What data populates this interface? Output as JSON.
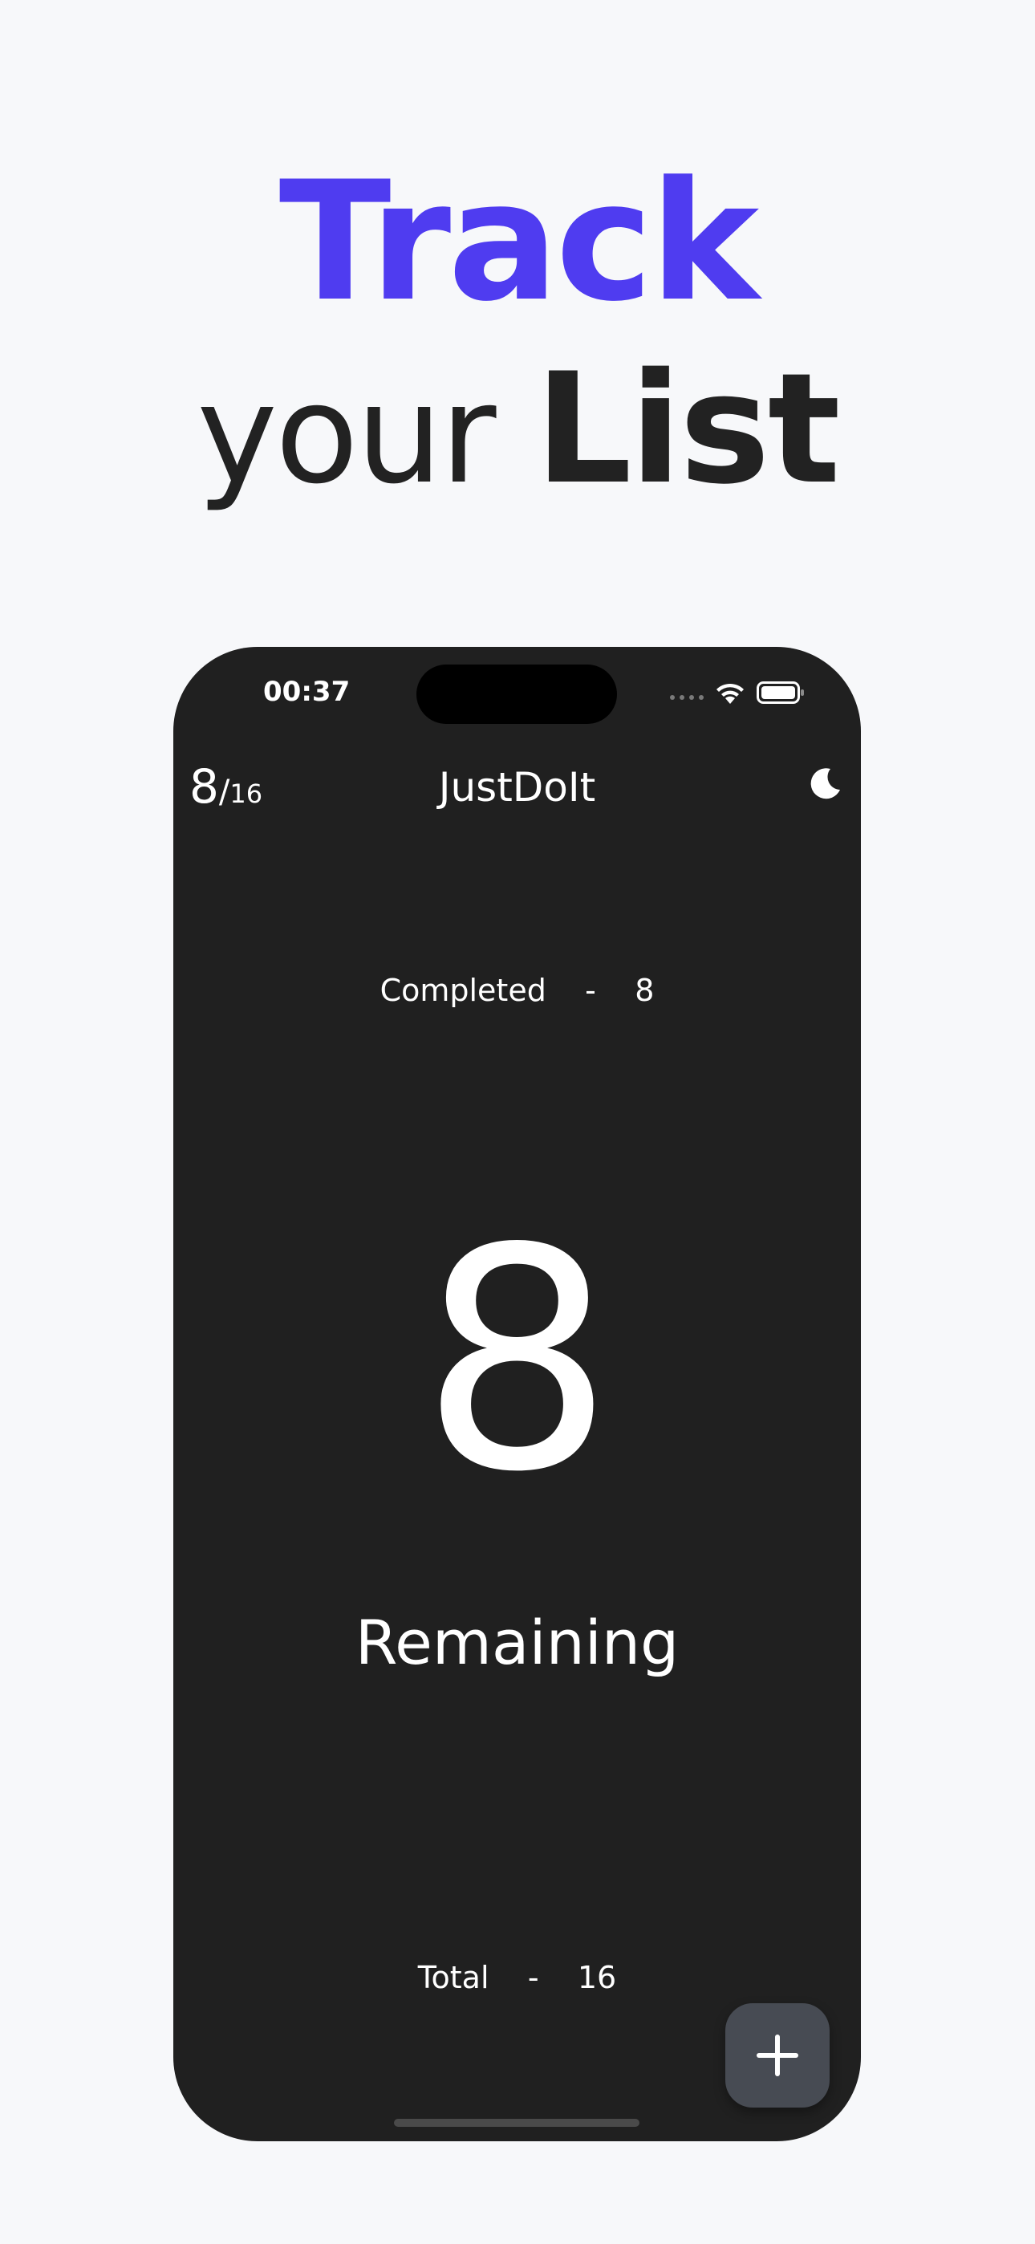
{
  "headline": {
    "line1": "Track",
    "line2_light": "your",
    "line2_bold": "List",
    "accent_color": "#4f3cf0"
  },
  "status_bar": {
    "time": "00:37",
    "icons": [
      "signal-dots-icon",
      "wifi-icon",
      "battery-icon"
    ]
  },
  "header": {
    "counter_done": "8",
    "counter_separator": "/",
    "counter_total": "16",
    "title": "JustDoIt",
    "theme_toggle_icon": "moon-icon"
  },
  "stats": {
    "completed_label": "Completed",
    "completed_separator": "-",
    "completed_value": "8",
    "remaining_value": "8",
    "remaining_label": "Remaining",
    "total_label": "Total",
    "total_separator": "-",
    "total_value": "16"
  },
  "fab": {
    "icon": "plus-icon"
  },
  "colors": {
    "page_background": "#f7f8fa",
    "phone_background": "#202020",
    "fab_background": "#474b53"
  }
}
